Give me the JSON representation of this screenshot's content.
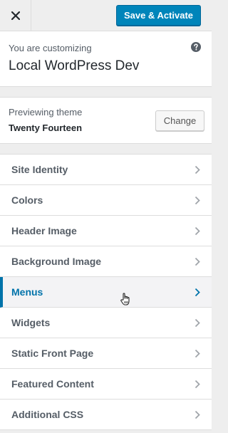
{
  "header": {
    "close_icon": "close-icon",
    "save_label": "Save & Activate",
    "accent_color": "#0085ba"
  },
  "info": {
    "customizing_label": "You are customizing",
    "site_title": "Local WordPress Dev",
    "help_icon": "help-icon"
  },
  "theme": {
    "preview_label": "Previewing theme",
    "name": "Twenty Fourteen",
    "change_label": "Change"
  },
  "sections": [
    {
      "label": "Site Identity"
    },
    {
      "label": "Colors"
    },
    {
      "label": "Header Image"
    },
    {
      "label": "Background Image"
    },
    {
      "label": "Menus",
      "active": true
    },
    {
      "label": "Widgets"
    },
    {
      "label": "Static Front Page"
    },
    {
      "label": "Featured Content"
    },
    {
      "label": "Additional CSS"
    }
  ],
  "active_color": "#0073aa"
}
